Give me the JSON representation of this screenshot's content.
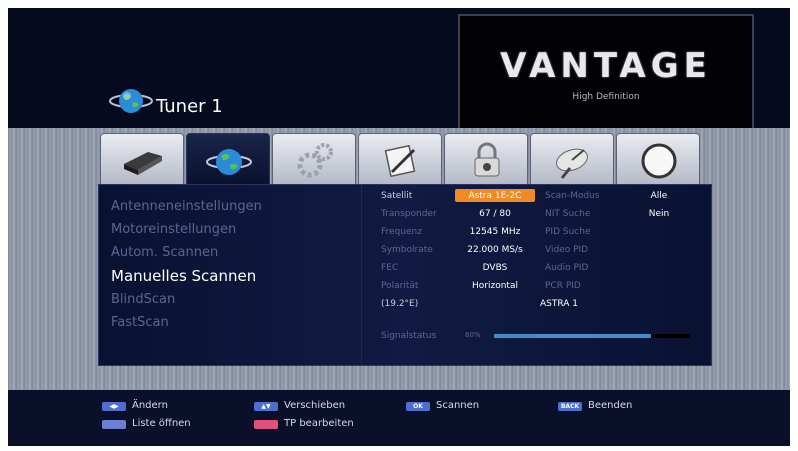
{
  "header": {
    "title": "Tuner 1"
  },
  "logo": {
    "brand": "VANTAGE",
    "tagline": "High Definition"
  },
  "tabs": [
    {
      "icon": "receiver-icon",
      "active": false
    },
    {
      "icon": "globe-icon",
      "active": true
    },
    {
      "icon": "gears-icon",
      "active": false
    },
    {
      "icon": "edit-icon",
      "active": false
    },
    {
      "icon": "lock-icon",
      "active": false
    },
    {
      "icon": "satellite-dish-icon",
      "active": false
    },
    {
      "icon": "power-icon",
      "active": false
    }
  ],
  "menu": {
    "items": [
      "Antenneneinstellungen",
      "Motoreinstellungen",
      "Autom. Scannen",
      "Manuelles Scannen",
      "BlindScan",
      "FastScan"
    ],
    "active_index": 3
  },
  "settings": {
    "satellit": {
      "label": "Satellit",
      "value": "Astra 1E-2C"
    },
    "transponder": {
      "label": "Transponder",
      "value": "67 / 80"
    },
    "frequenz": {
      "label": "Frequenz",
      "value": "12545 MHz"
    },
    "symbolrate": {
      "label": "Symbolrate",
      "value": "22.000 MS/s"
    },
    "fec": {
      "label": "FEC",
      "value": "DVBS"
    },
    "polaritat": {
      "label": "Polarität",
      "value": "Horizontal"
    },
    "position": {
      "label": "(19.2°E)",
      "value": "ASTRA 1"
    },
    "scan_modus": {
      "label": "Scan-Modus",
      "value": "Alle"
    },
    "nit_suche": {
      "label": "NIT Suche",
      "value": "Nein"
    },
    "pid_suche": {
      "label": "PID Suche"
    },
    "video_pid": {
      "label": "Video PID"
    },
    "audio_pid": {
      "label": "Audio PID"
    },
    "pcr_pid": {
      "label": "PCR PID"
    },
    "signal": {
      "label": "Signalstatus",
      "percent_label": "80%",
      "level": 80
    }
  },
  "footer": {
    "keys": [
      {
        "key": "◀▶",
        "label": "Ändern",
        "color": "#4e6fcf"
      },
      {
        "key": "▲▼",
        "label": "Verschieben",
        "color": "#4e6fcf"
      },
      {
        "key": "OK",
        "label": "Scannen",
        "color": "#4e6fcf"
      },
      {
        "key": "BACK",
        "label": "Beenden",
        "color": "#4e6fcf"
      },
      {
        "key": "",
        "label": "Liste öffnen",
        "color": "#6d7fd4"
      },
      {
        "key": "",
        "label": "TP bearbeiten",
        "color": "#e0507a"
      }
    ]
  },
  "colors": {
    "highlight": "#f08a24",
    "signal_bar": "#3d8ec9"
  }
}
